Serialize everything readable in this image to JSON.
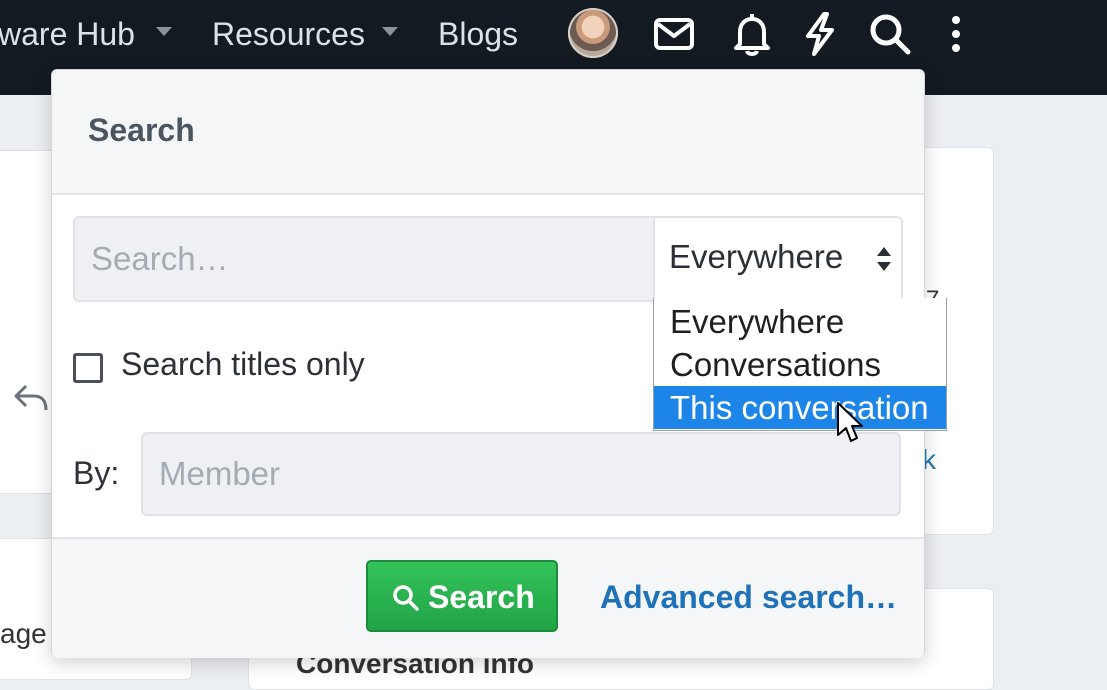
{
  "nav": {
    "items": [
      "ware Hub",
      "Resources",
      "Blogs"
    ],
    "icons": [
      "avatar",
      "envelope-icon",
      "bell-icon",
      "lightning-icon",
      "search-icon",
      "more-vertical-icon"
    ]
  },
  "background": {
    "left_fragment": "age",
    "right_link_fragment": "k",
    "right_mark_fragment": "7",
    "bottom_heading": "Conversation info"
  },
  "search_popup": {
    "title": "Search",
    "query_placeholder": "Search…",
    "scope_value": "Everywhere",
    "scope_options": [
      "Everywhere",
      "Conversations",
      "This conversation"
    ],
    "selected_option_index": 2,
    "titles_only_label": "Search titles only",
    "titles_only_checked": false,
    "by_label": "By:",
    "member_placeholder": "Member",
    "search_button": "Search",
    "advanced_link": "Advanced search…"
  },
  "colors": {
    "topbar": "#141a22",
    "accent_button": "#22a447",
    "link": "#1f72b8",
    "selected_option": "#1e85e8"
  }
}
